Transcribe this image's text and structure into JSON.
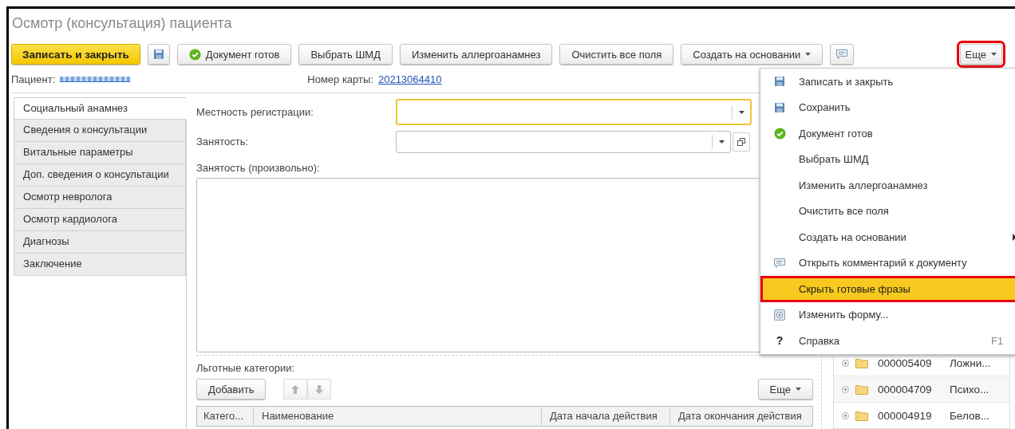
{
  "window": {
    "title": "Осмотр (консультация) пациента"
  },
  "toolbar": [
    {
      "kind": "primary",
      "label": "Записать и закрыть"
    },
    {
      "kind": "save"
    },
    {
      "kind": "ready",
      "label": "Документ готов"
    },
    {
      "kind": "plain",
      "label": "Выбрать ШМД"
    },
    {
      "kind": "plain",
      "label": "Изменить аллергоанамнез"
    },
    {
      "kind": "plain",
      "label": "Очистить все поля"
    },
    {
      "kind": "dropdown",
      "label": "Создать на основании"
    },
    {
      "kind": "comment"
    }
  ],
  "more_button": {
    "label": "Еще",
    "highlighted": true
  },
  "patient": {
    "label": "Пациент:"
  },
  "card": {
    "label": "Номер карты:",
    "value": "20213064410"
  },
  "tabs": [
    {
      "label": "Социальный анамнез",
      "selected": true
    },
    {
      "label": "Сведения о консультации",
      "selected": false
    },
    {
      "label": "Витальные параметры",
      "selected": false
    },
    {
      "label": "Доп. сведения о консультации",
      "selected": false
    },
    {
      "label": "Осмотр невролога",
      "selected": false
    },
    {
      "label": "Осмотр кардиолога",
      "selected": false
    },
    {
      "label": "Диагнозы",
      "selected": false
    },
    {
      "label": "Заключение",
      "selected": false
    }
  ],
  "fields": [
    {
      "label": "Местность регистрации:",
      "focused": true,
      "open_button": false
    },
    {
      "label": "Занятость:",
      "focused": false,
      "open_button": true
    }
  ],
  "free_text": {
    "label": "Занятость (произвольно):"
  },
  "benefits": {
    "label": "Льготные категории:",
    "add": "Добавить",
    "more": "Еще",
    "columns": [
      "Катего...",
      "Наименование",
      "Дата начала действия",
      "Дата окончания действия"
    ]
  },
  "tree_rows": [
    {
      "code": "000005409",
      "name": "Ложни..."
    },
    {
      "code": "000004709",
      "name": "Психо..."
    },
    {
      "code": "000004919",
      "name": "Белов..."
    }
  ],
  "menu": [
    {
      "kind": "save",
      "label": "Записать и закрыть",
      "selected": false,
      "highlighted": false
    },
    {
      "kind": "save",
      "label": "Сохранить",
      "selected": false,
      "highlighted": false
    },
    {
      "kind": "ready",
      "label": "Документ готов",
      "selected": false,
      "highlighted": false
    },
    {
      "kind": "plain",
      "label": "Выбрать ШМД",
      "selected": false,
      "highlighted": false
    },
    {
      "kind": "plain",
      "label": "Изменить аллергоанамнез",
      "selected": false,
      "highlighted": false
    },
    {
      "kind": "plain",
      "label": "Очистить все поля",
      "selected": false,
      "highlighted": false
    },
    {
      "kind": "plain",
      "label": "Создать на основании",
      "submenu": true,
      "selected": false,
      "highlighted": false
    },
    {
      "kind": "comment",
      "label": "Открыть комментарий к документу",
      "selected": false,
      "highlighted": false
    },
    {
      "kind": "plain",
      "label": "Скрыть готовые фразы",
      "selected": true,
      "highlighted": true
    },
    {
      "kind": "form",
      "label": "Изменить форму...",
      "selected": false,
      "highlighted": false
    },
    {
      "kind": "help",
      "glyph": "?",
      "label": "Справка",
      "shortcut": "F1",
      "selected": false,
      "highlighted": false
    }
  ]
}
